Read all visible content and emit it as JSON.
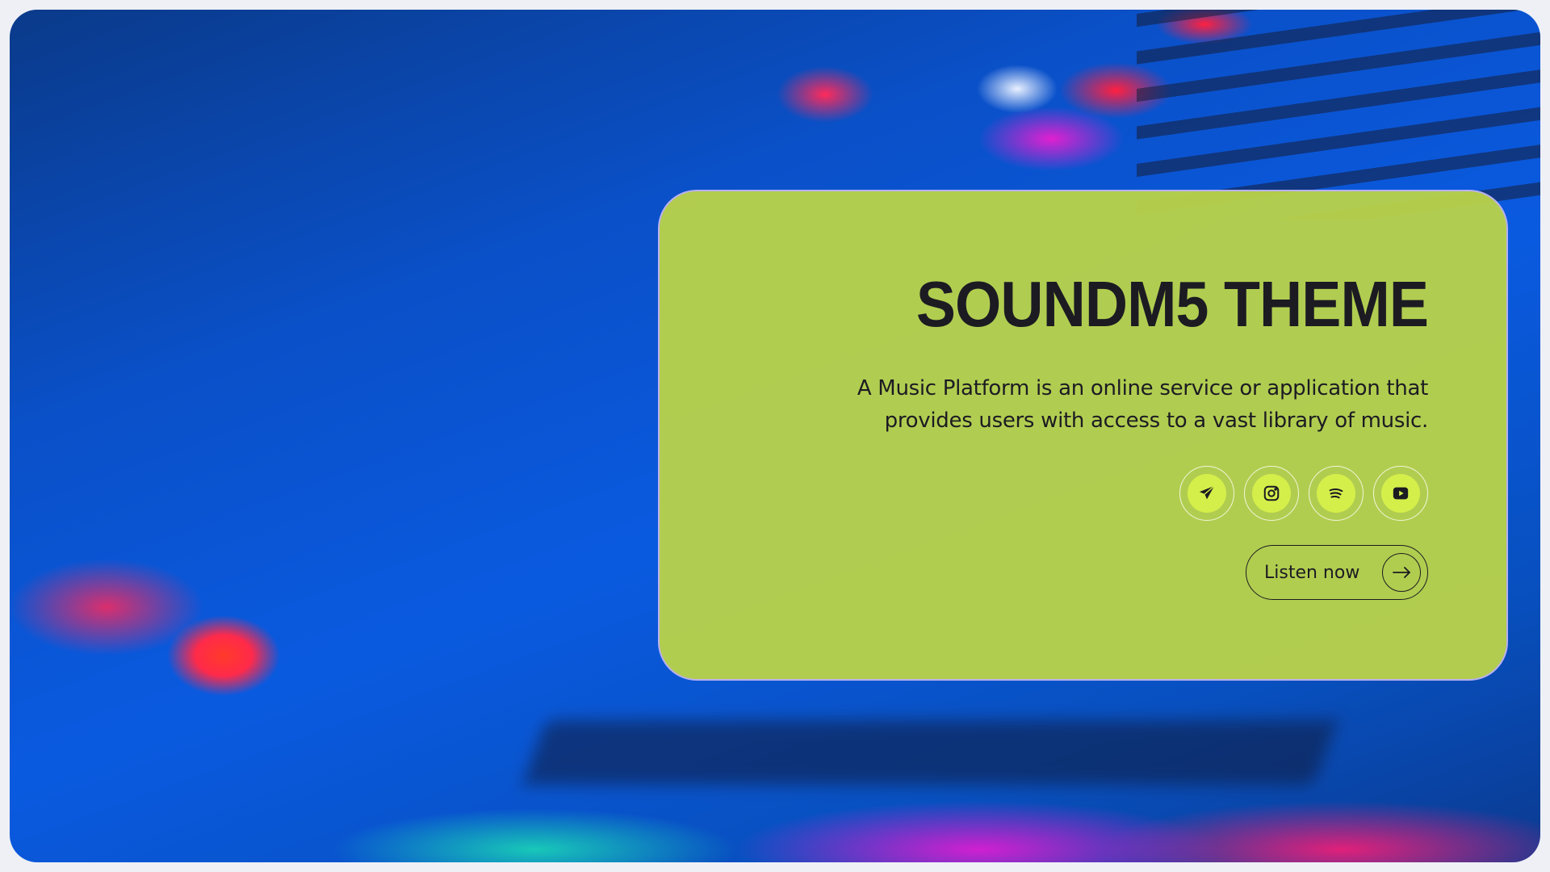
{
  "hero": {
    "title": "SOUNDM5 THEME",
    "description": "A Music Platform is an online service or application that provides users with access to a vast library of music.",
    "social": [
      {
        "name": "telegram-icon"
      },
      {
        "name": "instagram-icon"
      },
      {
        "name": "spotify-icon"
      },
      {
        "name": "youtube-icon"
      }
    ],
    "cta_label": "Listen now"
  },
  "colors": {
    "card": "#bed646",
    "accent": "#d4ef4a",
    "text": "#1c1b22"
  }
}
